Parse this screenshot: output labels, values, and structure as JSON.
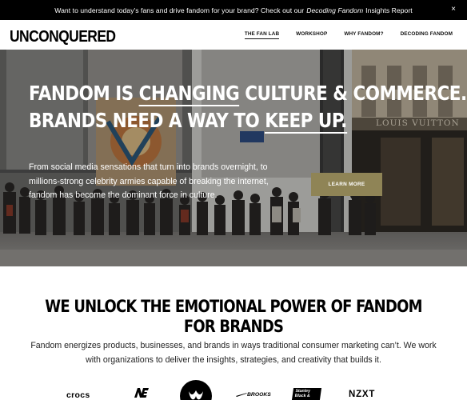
{
  "announcement": {
    "text_before": "Want to understand today's fans and drive fandom for your brand? Check out our",
    "report_name": "Decoding Fandom",
    "text_after": "Insights Report",
    "close": "×"
  },
  "header": {
    "logo": "UNCONQUERED",
    "nav": [
      {
        "label": "THE FAN LAB",
        "active": true
      },
      {
        "label": "WORKSHOP"
      },
      {
        "label": "WHY FANDOM?"
      },
      {
        "label": "DECODING FANDOM"
      }
    ]
  },
  "hero": {
    "headline_line1_a": "FANDOM IS ",
    "headline_line1_u": "CHANGING",
    "headline_line1_b": " CULTURE & COMMERCE.",
    "headline_line2_a": "BRANDS NEED A WAY TO ",
    "headline_line2_u": "KEEP UP.",
    "body": "From social media sensations that turn into brands overnight, to millions-strong celebrity armies capable of breaking the internet, fandom has become the dominant force in culture.",
    "cta": "LEARN MORE",
    "store_sign": "LOUIS VUITTON",
    "cta_color": "#8f8456"
  },
  "mission": {
    "heading": "WE UNLOCK THE EMOTIONAL POWER OF FANDOM FOR BRANDS",
    "body": "Fandom energizes products, businesses, and brands in ways traditional consumer marketing can’t. We work with organizations to deliver the insights, strategies, and creativity that builds it."
  },
  "client_logos": {
    "crocs": "crocs",
    "brooks": "BROOKS",
    "stanley_line1": "Stanley",
    "stanley_line2": "Black &",
    "stanley_line3": "Decker",
    "nzxt": "NZXT"
  }
}
